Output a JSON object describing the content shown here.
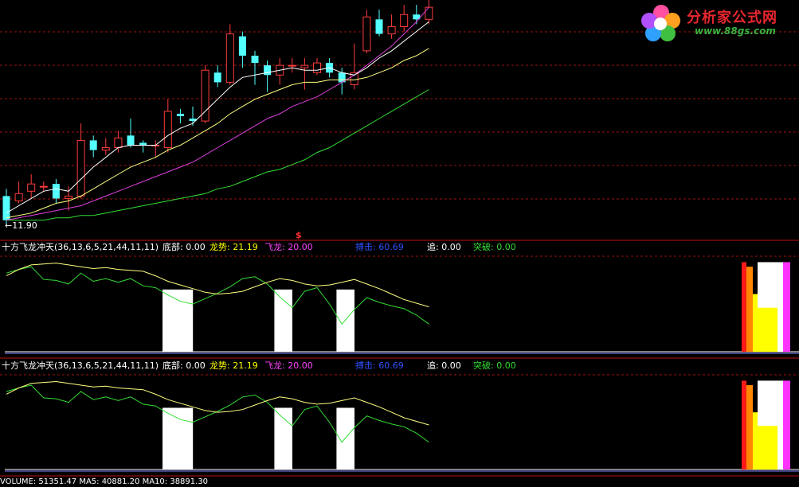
{
  "logo": {
    "text": "分析家公式网",
    "url": "www.88gs.com"
  },
  "price_panel": {
    "low_label": "11.90",
    "marker": "$"
  },
  "indicator_header": {
    "name": "十方飞龙冲天(36,13,6,5,21,44,11,11)",
    "items": [
      {
        "label": "底部:",
        "value": "0.00",
        "color": "#ffffff"
      },
      {
        "label": "龙势:",
        "value": "21.19",
        "color": "#ffff00"
      },
      {
        "label": "飞龙:",
        "value": "20.00",
        "color": "#ff44ff"
      },
      {
        "label": "搏击:",
        "value": "60.69",
        "color": "#3050ff"
      },
      {
        "label": "追:",
        "value": "0.00",
        "color": "#ffffff"
      },
      {
        "label": "突破:",
        "value": "0.00",
        "color": "#33dd33"
      }
    ]
  },
  "volume_footer": "VOLUME: 51351.47  MA5: 40881.20  MA10: 38891.30",
  "chart_data": {
    "type": "candlestick",
    "low_marker": 11.9,
    "candles": [
      {
        "o": 12.9,
        "c": 11.9,
        "h": 13.2,
        "l": 11.7
      },
      {
        "o": 12.7,
        "c": 13.0,
        "h": 13.5,
        "l": 12.6
      },
      {
        "o": 13.1,
        "c": 13.4,
        "h": 13.8,
        "l": 12.8
      },
      {
        "o": 13.3,
        "c": 13.3,
        "h": 13.5,
        "l": 13.1
      },
      {
        "o": 13.4,
        "c": 12.8,
        "h": 13.6,
        "l": 12.6
      },
      {
        "o": 12.8,
        "c": 12.9,
        "h": 13.3,
        "l": 12.3
      },
      {
        "o": 12.9,
        "c": 15.2,
        "h": 15.9,
        "l": 12.8
      },
      {
        "o": 15.2,
        "c": 14.8,
        "h": 15.4,
        "l": 14.5
      },
      {
        "o": 14.8,
        "c": 14.9,
        "h": 15.3,
        "l": 14.6
      },
      {
        "o": 14.9,
        "c": 15.3,
        "h": 15.6,
        "l": 14.7
      },
      {
        "o": 15.4,
        "c": 15.0,
        "h": 16.1,
        "l": 14.9
      },
      {
        "o": 15.1,
        "c": 15.0,
        "h": 15.2,
        "l": 14.7
      },
      {
        "o": 15.0,
        "c": 15.0,
        "h": 15.2,
        "l": 14.5
      },
      {
        "o": 14.9,
        "c": 16.4,
        "h": 16.9,
        "l": 14.7
      },
      {
        "o": 16.3,
        "c": 16.2,
        "h": 16.5,
        "l": 15.9
      },
      {
        "o": 16.1,
        "c": 16.0,
        "h": 16.6,
        "l": 15.8
      },
      {
        "o": 16.0,
        "c": 18.1,
        "h": 18.3,
        "l": 15.9
      },
      {
        "o": 18.0,
        "c": 17.6,
        "h": 18.3,
        "l": 17.4
      },
      {
        "o": 17.6,
        "c": 19.6,
        "h": 20.0,
        "l": 17.5
      },
      {
        "o": 19.5,
        "c": 18.7,
        "h": 19.7,
        "l": 18.2
      },
      {
        "o": 18.7,
        "c": 18.4,
        "h": 18.9,
        "l": 17.5
      },
      {
        "o": 18.3,
        "c": 17.9,
        "h": 18.5,
        "l": 17.2
      },
      {
        "o": 17.9,
        "c": 18.3,
        "h": 18.6,
        "l": 17.5
      },
      {
        "o": 18.3,
        "c": 18.3,
        "h": 18.6,
        "l": 18.0
      },
      {
        "o": 18.2,
        "c": 18.3,
        "h": 18.6,
        "l": 17.3
      },
      {
        "o": 18.0,
        "c": 18.4,
        "h": 18.6,
        "l": 17.9
      },
      {
        "o": 18.4,
        "c": 18.0,
        "h": 18.6,
        "l": 17.8
      },
      {
        "o": 18.0,
        "c": 17.6,
        "h": 18.2,
        "l": 17.1
      },
      {
        "o": 17.5,
        "c": 18.0,
        "h": 19.2,
        "l": 17.3
      },
      {
        "o": 18.9,
        "c": 20.3,
        "h": 20.6,
        "l": 18.8
      },
      {
        "o": 20.2,
        "c": 19.6,
        "h": 20.6,
        "l": 19.5
      },
      {
        "o": 19.6,
        "c": 19.9,
        "h": 20.4,
        "l": 19.4
      },
      {
        "o": 19.9,
        "c": 20.4,
        "h": 20.8,
        "l": 19.7
      },
      {
        "o": 20.4,
        "c": 20.2,
        "h": 20.8,
        "l": 20.0
      },
      {
        "o": 20.2,
        "c": 20.7,
        "h": 21.0,
        "l": 20.0
      }
    ],
    "ma_short": [
      12.2,
      12.5,
      12.8,
      13.1,
      13.2,
      13.1,
      13.6,
      14.1,
      14.5,
      14.9,
      15.0,
      15.0,
      15.0,
      15.4,
      15.7,
      15.9,
      16.4,
      16.9,
      17.4,
      17.8,
      17.9,
      18.0,
      18.1,
      18.2,
      18.1,
      18.1,
      18.2,
      18.0,
      17.9,
      18.2,
      18.6,
      18.9,
      19.3,
      19.7,
      20.1
    ],
    "ma_mid": [
      12.0,
      12.1,
      12.2,
      12.4,
      12.6,
      12.7,
      12.9,
      13.2,
      13.5,
      13.8,
      14.1,
      14.3,
      14.5,
      14.8,
      15.0,
      15.3,
      15.6,
      15.9,
      16.3,
      16.6,
      16.9,
      17.1,
      17.3,
      17.5,
      17.6,
      17.6,
      17.7,
      17.7,
      17.7,
      17.8,
      18.0,
      18.2,
      18.5,
      18.7,
      19.0
    ],
    "ma_slow": [
      11.9,
      12.0,
      12.1,
      12.2,
      12.3,
      12.4,
      12.5,
      12.7,
      12.9,
      13.1,
      13.3,
      13.5,
      13.7,
      13.9,
      14.1,
      14.3,
      14.6,
      14.9,
      15.2,
      15.5,
      15.8,
      16.1,
      16.3,
      16.6,
      16.8,
      17.0,
      17.3,
      17.6,
      17.9,
      18.3,
      18.7,
      19.1,
      19.6,
      20.1,
      20.7
    ],
    "ma_long": [
      11.9,
      11.9,
      11.9,
      11.9,
      12.0,
      12.0,
      12.1,
      12.1,
      12.2,
      12.3,
      12.4,
      12.5,
      12.6,
      12.7,
      12.8,
      12.9,
      13.0,
      13.2,
      13.3,
      13.5,
      13.7,
      13.9,
      14.0,
      14.2,
      14.4,
      14.7,
      14.9,
      15.2,
      15.5,
      15.8,
      16.1,
      16.4,
      16.7,
      17.0,
      17.3
    ],
    "indicator": {
      "yellow": [
        85,
        92,
        97,
        98,
        99,
        97,
        95,
        93,
        94,
        92,
        91,
        90,
        85,
        79,
        75,
        71,
        67,
        65,
        66,
        68,
        73,
        78,
        82,
        80,
        76,
        74,
        75,
        78,
        81,
        76,
        71,
        65,
        59,
        55,
        51
      ],
      "green": [
        88,
        92,
        95,
        81,
        80,
        76,
        88,
        79,
        82,
        78,
        82,
        74,
        72,
        64,
        57,
        54,
        60,
        66,
        73,
        82,
        84,
        76,
        62,
        50,
        68,
        72,
        54,
        32,
        48,
        61,
        56,
        52,
        49,
        42,
        32
      ],
      "white_blocks": [
        [
          13,
          14
        ],
        [
          22,
          22
        ],
        [
          27,
          27
        ]
      ],
      "end_bars": [
        {
          "color": "#ff1a1a",
          "v": 100
        },
        {
          "color": "#ff8800",
          "v": 95
        },
        {
          "color": "#ffff00",
          "v": 65
        },
        {
          "color": "#ffffff",
          "v": 100
        },
        {
          "color": "#ff33ff",
          "v": 100
        }
      ]
    }
  }
}
